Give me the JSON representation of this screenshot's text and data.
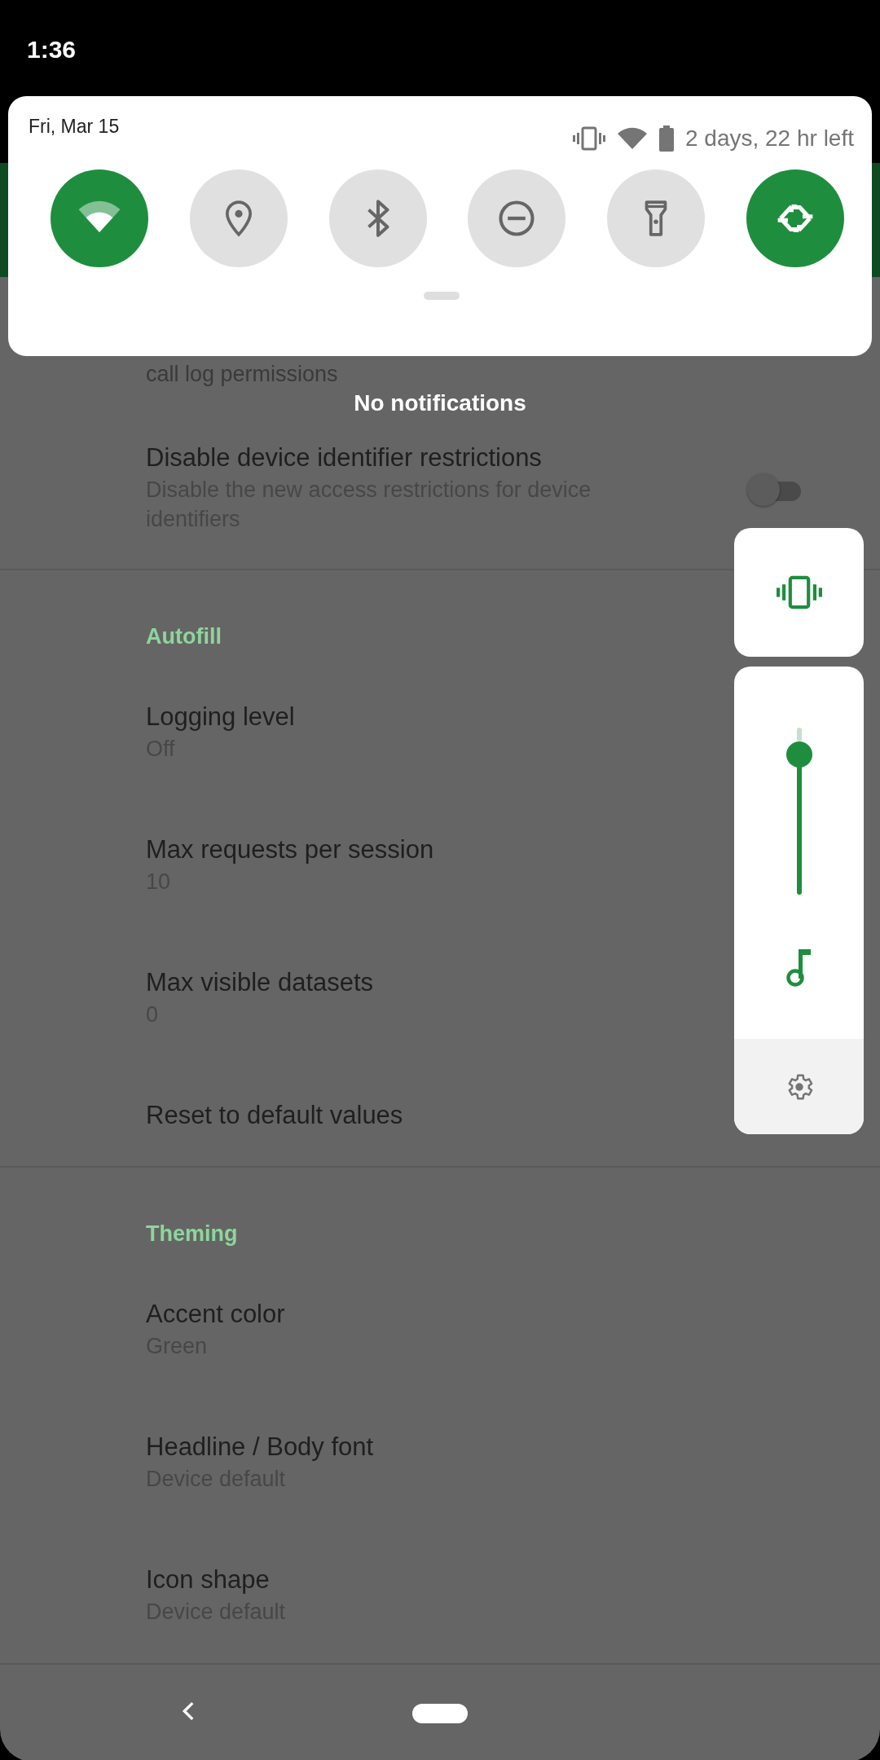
{
  "status_bar": {
    "time": "1:36"
  },
  "quick_settings": {
    "date": "Fri, Mar 15",
    "battery_text": "2 days, 22 hr left",
    "tiles": [
      {
        "kind": "wifi",
        "on": true
      },
      {
        "kind": "location",
        "on": false
      },
      {
        "kind": "bluetooth",
        "on": false
      },
      {
        "kind": "dnd",
        "on": false
      },
      {
        "kind": "flashlight",
        "on": false
      },
      {
        "kind": "rotate",
        "on": true
      }
    ]
  },
  "notifications": {
    "empty_text": "No notifications"
  },
  "settings": [
    {
      "kind": "partial",
      "subtitle": "call log permissions"
    },
    {
      "kind": "switch",
      "title": "Disable device identifier restrictions",
      "subtitle": "Disable the new access restrictions for device identifiers",
      "on": false
    },
    {
      "kind": "header",
      "title": "Autofill"
    },
    {
      "kind": "item",
      "title": "Logging level",
      "subtitle": "Off"
    },
    {
      "kind": "item",
      "title": "Max requests per session",
      "subtitle": "10"
    },
    {
      "kind": "item",
      "title": "Max visible datasets",
      "subtitle": "0"
    },
    {
      "kind": "item",
      "title": "Reset to default values"
    },
    {
      "kind": "header",
      "title": "Theming"
    },
    {
      "kind": "item",
      "title": "Accent color",
      "subtitle": "Green"
    },
    {
      "kind": "item",
      "title": "Headline / Body font",
      "subtitle": "Device default"
    },
    {
      "kind": "item",
      "title": "Icon shape",
      "subtitle": "Device default"
    }
  ],
  "volume_dialog": {
    "level": 0.84
  }
}
